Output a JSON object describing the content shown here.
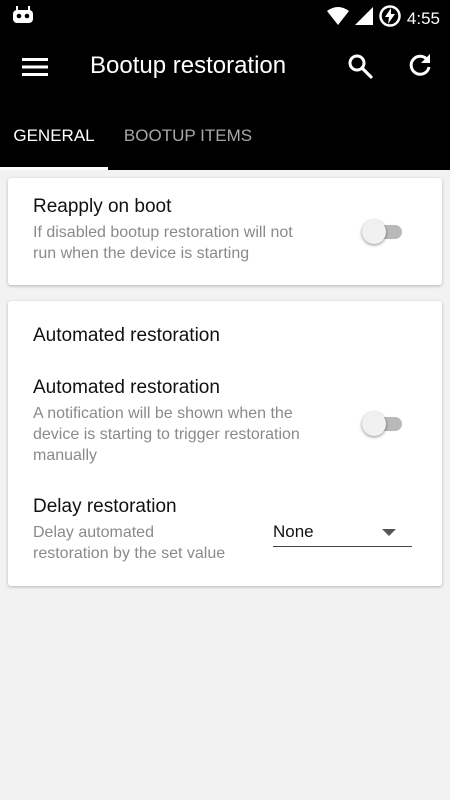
{
  "status_bar": {
    "time": "4:55"
  },
  "app_bar": {
    "title": "Bootup restoration"
  },
  "tabs": [
    {
      "label": "GENERAL",
      "selected": true
    },
    {
      "label": "BOOTUP ITEMS",
      "selected": false
    }
  ],
  "card_boot": {
    "title": "Reapply on boot",
    "summary_line1": "If disabled bootup restoration will not",
    "summary_line2": "run when the device is starting",
    "enabled": false
  },
  "card_automated": {
    "section_title": "Automated restoration",
    "automated": {
      "title": "Automated restoration",
      "summary_line1": "A notification will be shown when the",
      "summary_line2": "device is starting to trigger restoration",
      "summary_line3": "manually",
      "enabled": false
    },
    "delay": {
      "title": "Delay restoration",
      "summary_line1": "Delay automated",
      "summary_line2": "restoration by the set value",
      "selected_value": "None"
    }
  },
  "colors": {
    "app_bar": "#000000",
    "background": "#f2f2f2",
    "card": "#ffffff"
  }
}
